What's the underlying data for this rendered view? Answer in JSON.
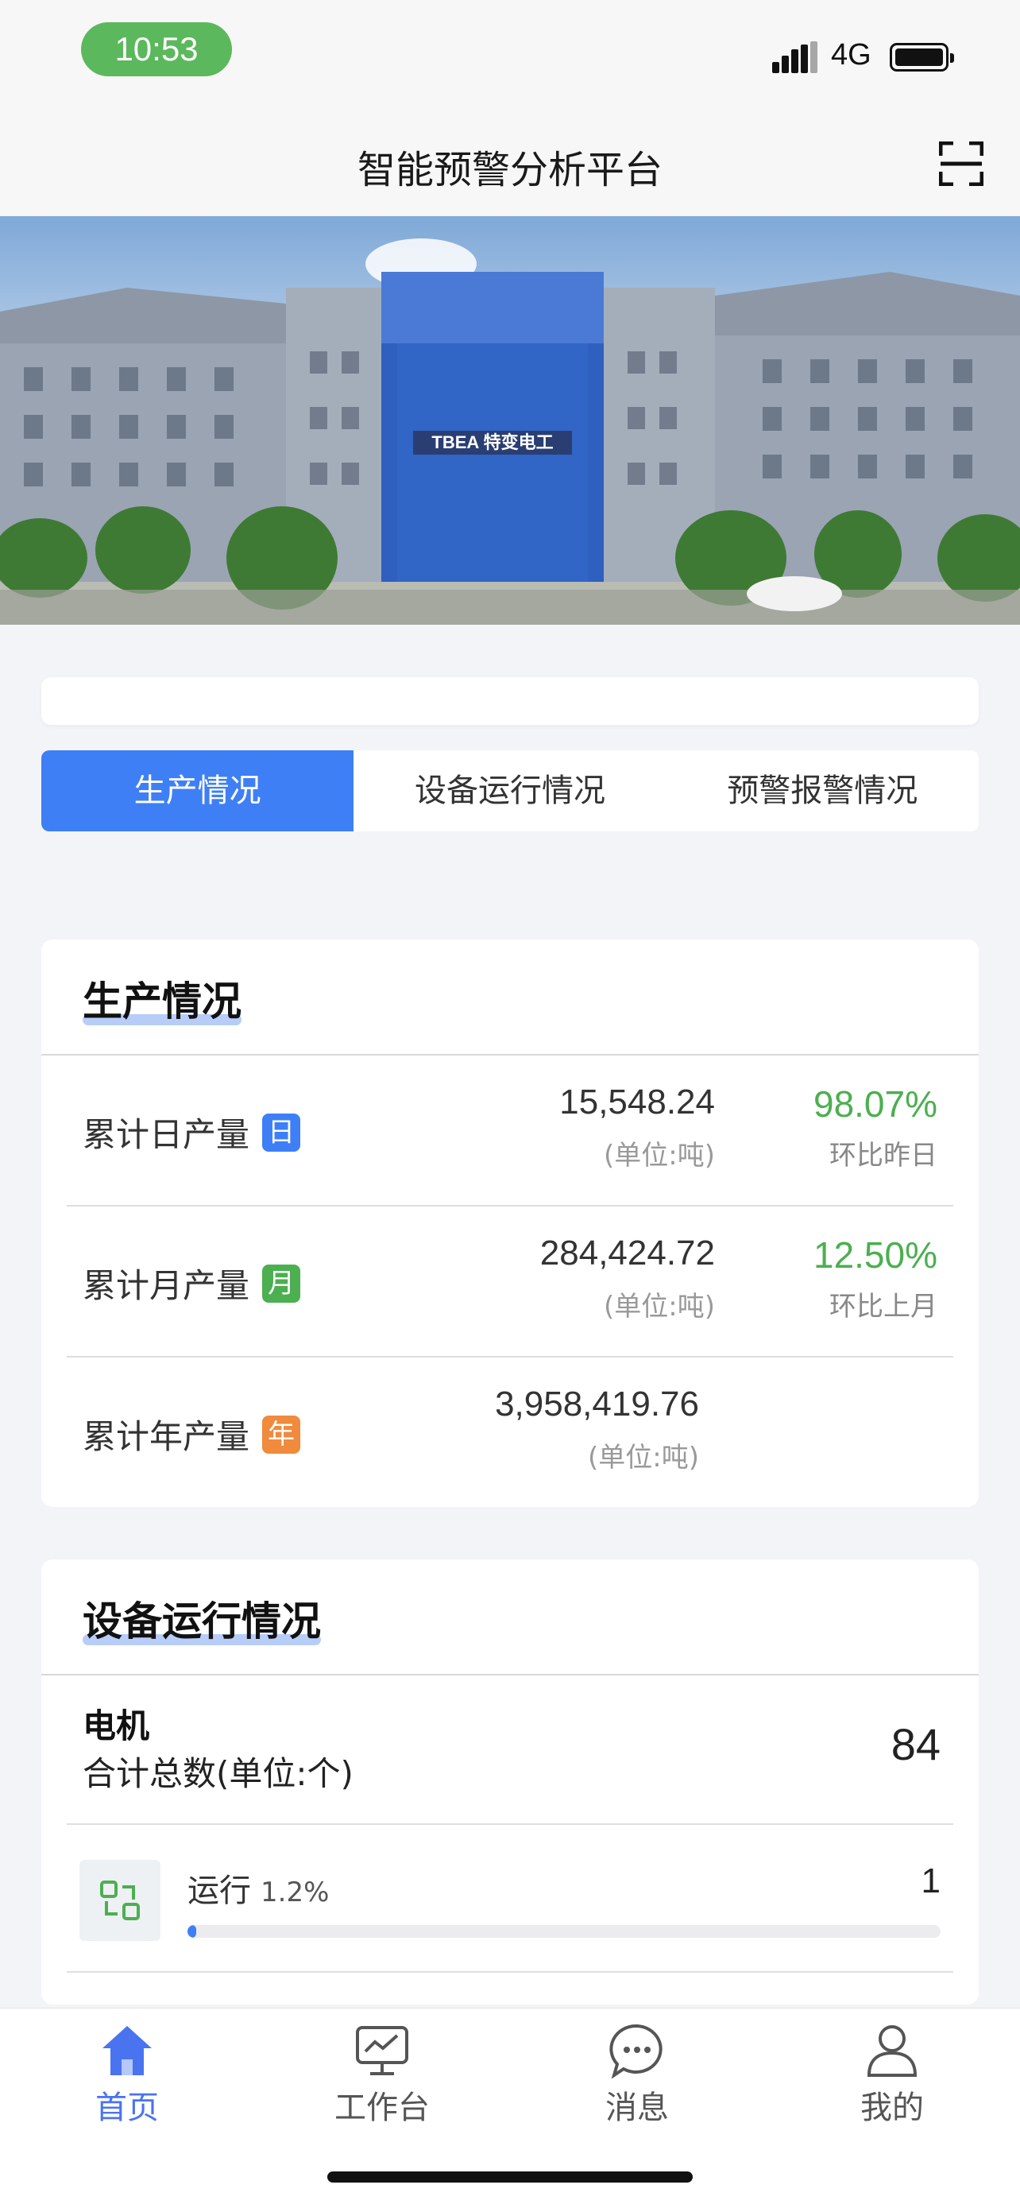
{
  "status_bar": {
    "time": "10:53",
    "network": "4G"
  },
  "header": {
    "title": "智能预警分析平台",
    "scan_icon": "scan-icon"
  },
  "banner": {
    "sign_text": "TBEA 特变电工",
    "dots": [
      {
        "active": false
      },
      {
        "active": true
      },
      {
        "active": false
      }
    ]
  },
  "tabs": [
    {
      "label": "生产情况",
      "active": true
    },
    {
      "label": "设备运行情况",
      "active": false
    },
    {
      "label": "预警报警情况",
      "active": false
    }
  ],
  "production": {
    "title": "生产情况",
    "rows": [
      {
        "label": "累计日产量",
        "badge": "日",
        "badge_color": "#3f7ff6",
        "value": "15,548.24",
        "unit": "(单位:吨)",
        "pct": "98.07%",
        "compare": "环比昨日"
      },
      {
        "label": "累计月产量",
        "badge": "月",
        "badge_color": "#4caf50",
        "value": "284,424.72",
        "unit": "(单位:吨)",
        "pct": "12.50%",
        "compare": "环比上月"
      },
      {
        "label": "累计年产量",
        "badge": "年",
        "badge_color": "#f08a3c",
        "value": "3,958,419.76",
        "unit": "(单位:吨)",
        "pct": "",
        "compare": ""
      }
    ]
  },
  "devices": {
    "title": "设备运行情况",
    "name": "电机",
    "subtitle": "合计总数(单位:个)",
    "total": "84",
    "status": {
      "label": "运行",
      "percent_text": "1.2%",
      "count": "1",
      "fill_fraction": 0.012
    }
  },
  "colors": {
    "accent": "#3f7ff6",
    "positive": "#4caf50",
    "nav_active": "#4a73f0"
  },
  "nav": [
    {
      "label": "首页",
      "icon": "home-icon",
      "active": true
    },
    {
      "label": "工作台",
      "icon": "workbench-icon",
      "active": false
    },
    {
      "label": "消息",
      "icon": "message-icon",
      "active": false
    },
    {
      "label": "我的",
      "icon": "profile-icon",
      "active": false
    }
  ]
}
